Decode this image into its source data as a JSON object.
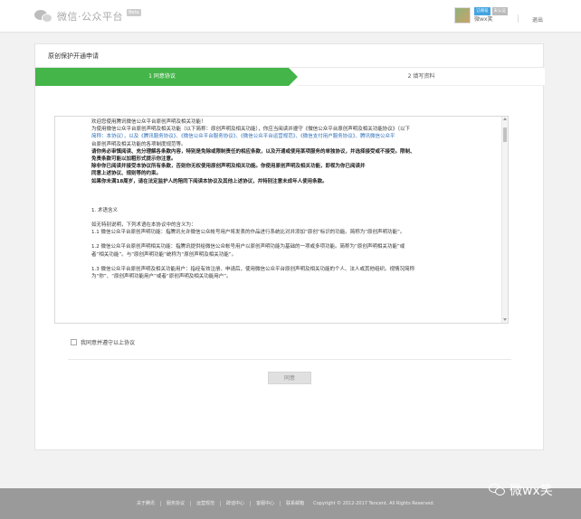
{
  "header": {
    "brand": "微信·公众平台",
    "badge": "Beta",
    "user_tags": [
      "订阅号",
      "未认证"
    ],
    "username": "微wx笑",
    "logout": "退出"
  },
  "card": {
    "title": "原创保护开通申请",
    "steps": [
      {
        "label": "1 同意协议",
        "active": true
      },
      {
        "label": "2 填写资料",
        "active": false
      }
    ]
  },
  "agreement": {
    "lines": [
      {
        "text": "欢迎您使用腾讯微信公众平台原创声明及相关功能！",
        "style": "normal"
      },
      {
        "text": "为使用微信公众平台原创声明及相关功能（以下简称：原创声明及相关功能），你应当阅读并遵守《微信公众平台原创声明及相关功能协议》（以下",
        "style": "normal"
      },
      {
        "text": "简称：本协议），以及《腾讯服务协议》、《微信公众平台服务协议》、《微信公众平台运营规范》、《微信支付用户服务协议》、腾讯微信公众平",
        "style": "link"
      },
      {
        "text": "台原创声明及相关功能的各项制度规范等。",
        "style": "normal"
      },
      {
        "text": "请你务必审慎阅读、充分理解各条款内容，特别是免除或限制责任的相应条款，以及开通或使用某项服务的单独协议，并选择接受或不接受。限制、",
        "style": "bold"
      },
      {
        "text": "免责条款可能以加粗形式提示你注意。",
        "style": "bold"
      },
      {
        "text": "除非你已阅读并接受本协议所有条款，否则你无权使用原创声明及相关功能。你使用原创声明及相关功能，即视为你已阅读并",
        "style": "bold"
      },
      {
        "text": "同意上述协议、规则等的约束。",
        "style": "bold"
      },
      {
        "text": "如果你未满18周岁，请在法定监护人的陪同下阅读本协议及其他上述协议，并特别注意未成年人使用条款。",
        "style": "bold"
      },
      {
        "text": "",
        "style": "gap"
      },
      {
        "text": "",
        "style": "gap"
      },
      {
        "text": "",
        "style": "gap"
      },
      {
        "text": "1. 术语含义",
        "style": "normal"
      },
      {
        "text": "",
        "style": "gap"
      },
      {
        "text": "如无特别说明，下列术语在本协议中的含义为：",
        "style": "normal"
      },
      {
        "text": "1.1 微信公众平台原创声明功能：指腾讯允许微信公众帐号用户将发表的作品进行系统比对并添加“原创”标识的功能。简称为“原创声明功能”。",
        "style": "normal"
      },
      {
        "text": "",
        "style": "gap"
      },
      {
        "text": "1.2 微信公众平台原创声明相关功能：指腾讯提供给微信公众帐号用户以原创声明功能为基础的一项或多项功能。简称为“原创声明相关功能”或",
        "style": "normal"
      },
      {
        "text": "者“相关功能”。与“原创声明功能”统称为“原创声明及相关功能”。",
        "style": "normal"
      },
      {
        "text": "",
        "style": "gap"
      },
      {
        "text": "1.3 微信公众平台原创声明及相关功能用户：指经有效注册、申请后，使用微信公众平台原创声明及相关功能的个人、法人或其他组织。视情况简称",
        "style": "normal"
      },
      {
        "text": "为“你”、“原创声明功能用户”或者“原创声明及相关功能用户”。",
        "style": "normal"
      }
    ]
  },
  "agree_checkbox": {
    "label": "我同意并遵守以上协议",
    "checked": false
  },
  "agree_button": {
    "label": "同意"
  },
  "footer": {
    "links": [
      "关于腾讯",
      "服务协议",
      "运营规范",
      "辟谣中心",
      "客服中心",
      "联系邮箱"
    ],
    "copyright": "Copyright © 2012-2017 Tencent. All Rights Reserved."
  },
  "watermark": {
    "text": "微wx笑"
  },
  "colors": {
    "accent": "#44b549",
    "link": "#2b6db8",
    "footer": "#9a9a9a"
  }
}
